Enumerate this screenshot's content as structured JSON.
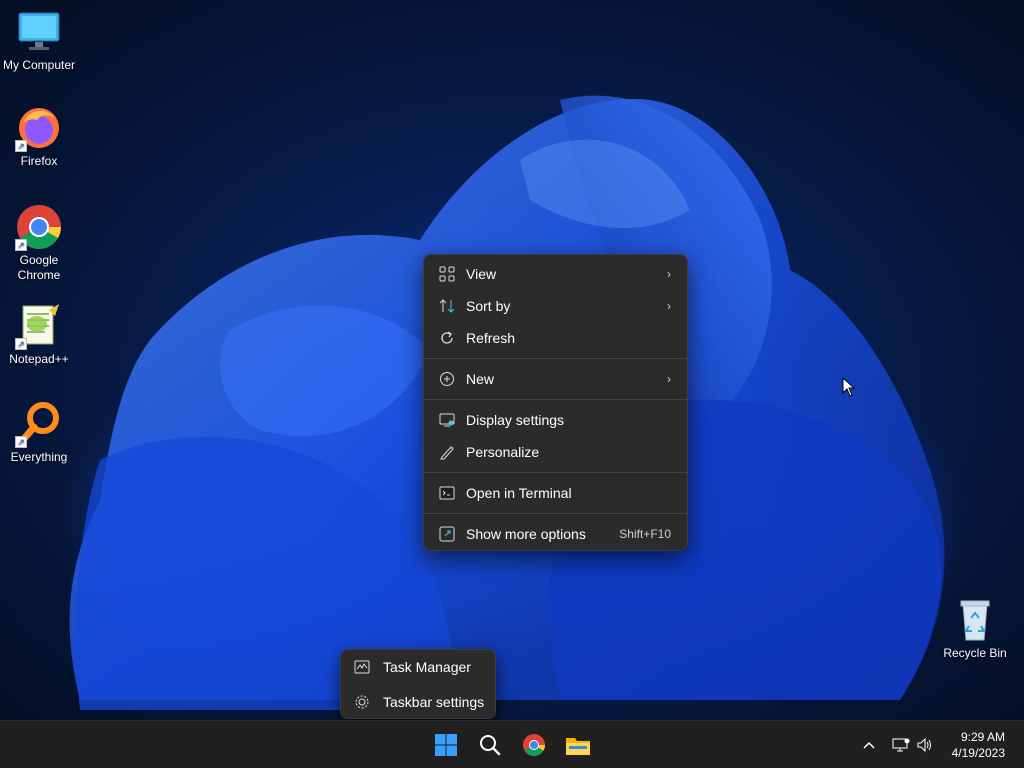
{
  "desktop": {
    "icons": [
      {
        "label": "My Computer"
      },
      {
        "label": "Firefox"
      },
      {
        "label": "Google\nChrome"
      },
      {
        "label": "Notepad++"
      },
      {
        "label": "Everything"
      },
      {
        "label": "Recycle Bin"
      }
    ]
  },
  "context_menu": {
    "items": [
      {
        "label": "View",
        "icon": "grid-view-icon",
        "submenu": true
      },
      {
        "label": "Sort by",
        "icon": "sort-icon",
        "submenu": true
      },
      {
        "label": "Refresh",
        "icon": "refresh-icon"
      },
      {
        "label": "New",
        "icon": "plus-circle-icon",
        "submenu": true
      },
      {
        "label": "Display settings",
        "icon": "display-icon"
      },
      {
        "label": "Personalize",
        "icon": "pencil-icon"
      },
      {
        "label": "Open in Terminal",
        "icon": "terminal-icon"
      },
      {
        "label": "Show more options",
        "icon": "share-icon",
        "shortcut": "Shift+F10"
      }
    ]
  },
  "taskbar_menu": {
    "items": [
      {
        "label": "Task Manager",
        "icon": "task-manager-icon"
      },
      {
        "label": "Taskbar settings",
        "icon": "gear-icon"
      }
    ]
  },
  "taskbar": {
    "apps": [
      "start-icon",
      "search-icon",
      "chrome-icon",
      "file-explorer-icon"
    ],
    "clock": {
      "time": "9:29 AM",
      "date": "4/19/2023"
    }
  },
  "colors": {
    "menu_bg": "#2b2b2b",
    "taskbar_bg": "#202020",
    "accent": "#1a73e8"
  }
}
